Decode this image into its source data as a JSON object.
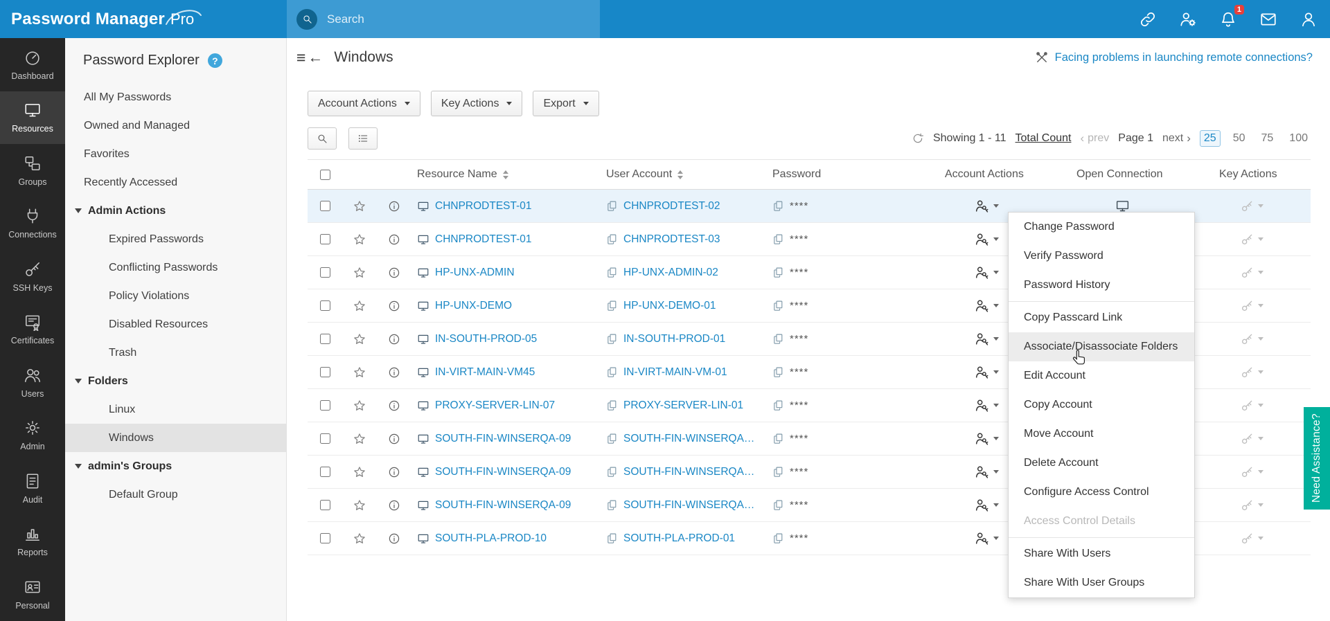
{
  "topbar": {
    "brand": {
      "name": "Password Manager",
      "suffix": "Pro"
    },
    "search": {
      "placeholder": "Search"
    },
    "notification_badge": "1",
    "icons": [
      "remote-connection",
      "user-settings",
      "notifications",
      "mail",
      "profile"
    ]
  },
  "nav": {
    "items": [
      {
        "id": "dashboard",
        "label": "Dashboard",
        "active": false
      },
      {
        "id": "resources",
        "label": "Resources",
        "active": true
      },
      {
        "id": "groups",
        "label": "Groups",
        "active": false
      },
      {
        "id": "connections",
        "label": "Connections",
        "active": false
      },
      {
        "id": "ssh-keys",
        "label": "SSH Keys",
        "active": false
      },
      {
        "id": "certificates",
        "label": "Certificates",
        "active": false
      },
      {
        "id": "users",
        "label": "Users",
        "active": false
      },
      {
        "id": "admin",
        "label": "Admin",
        "active": false
      },
      {
        "id": "audit",
        "label": "Audit",
        "active": false
      },
      {
        "id": "reports",
        "label": "Reports",
        "active": false
      },
      {
        "id": "personal",
        "label": "Personal",
        "active": false
      }
    ]
  },
  "explorer": {
    "title": "Password Explorer",
    "items": [
      {
        "label": "All My Passwords",
        "type": "item"
      },
      {
        "label": "Owned and Managed",
        "type": "item"
      },
      {
        "label": "Favorites",
        "type": "item"
      },
      {
        "label": "Recently Accessed",
        "type": "item"
      },
      {
        "label": "Admin Actions",
        "type": "section"
      },
      {
        "label": "Expired Passwords",
        "type": "child"
      },
      {
        "label": "Conflicting Passwords",
        "type": "child"
      },
      {
        "label": "Policy Violations",
        "type": "child"
      },
      {
        "label": "Disabled Resources",
        "type": "child"
      },
      {
        "label": "Trash",
        "type": "child"
      },
      {
        "label": "Folders",
        "type": "section"
      },
      {
        "label": "Linux",
        "type": "child"
      },
      {
        "label": "Windows",
        "type": "child",
        "selected": true
      },
      {
        "label": "admin's Groups",
        "type": "section"
      },
      {
        "label": "Default Group",
        "type": "child"
      }
    ]
  },
  "main": {
    "title": "Windows",
    "help_link": "Facing problems in launching remote connections?",
    "toolbar": [
      {
        "label": "Account Actions"
      },
      {
        "label": "Key Actions"
      },
      {
        "label": "Export"
      }
    ],
    "pagination": {
      "showing": "Showing 1 - 11",
      "total_count_link": "Total Count",
      "prev": "prev",
      "page": "Page 1",
      "next": "next",
      "page_sizes": [
        "25",
        "50",
        "75",
        "100"
      ],
      "selected_size": "25"
    },
    "table": {
      "columns": [
        {
          "label": "Resource Name",
          "sortable": true
        },
        {
          "label": "User Account",
          "sortable": true
        },
        {
          "label": "Password",
          "sortable": false
        },
        {
          "label": "Account Actions",
          "sortable": false
        },
        {
          "label": "Open Connection",
          "sortable": false
        },
        {
          "label": "Key Actions",
          "sortable": false
        }
      ],
      "password_mask": "****",
      "rows": [
        {
          "resource": "CHNPRODTEST-01",
          "account": "CHNPRODTEST-02",
          "selected": true
        },
        {
          "resource": "CHNPRODTEST-01",
          "account": "CHNPRODTEST-03"
        },
        {
          "resource": "HP-UNX-ADMIN",
          "account": "HP-UNX-ADMIN-02"
        },
        {
          "resource": "HP-UNX-DEMO",
          "account": "HP-UNX-DEMO-01"
        },
        {
          "resource": "IN-SOUTH-PROD-05",
          "account": "IN-SOUTH-PROD-01"
        },
        {
          "resource": "IN-VIRT-MAIN-VM45",
          "account": "IN-VIRT-MAIN-VM-01"
        },
        {
          "resource": "PROXY-SERVER-LIN-07",
          "account": "PROXY-SERVER-LIN-01"
        },
        {
          "resource": "SOUTH-FIN-WINSERQA-09",
          "account": "SOUTH-FIN-WINSERQA…"
        },
        {
          "resource": "SOUTH-FIN-WINSERQA-09",
          "account": "SOUTH-FIN-WINSERQA…"
        },
        {
          "resource": "SOUTH-FIN-WINSERQA-09",
          "account": "SOUTH-FIN-WINSERQA…"
        },
        {
          "resource": "SOUTH-PLA-PROD-10",
          "account": "SOUTH-PLA-PROD-01"
        }
      ]
    }
  },
  "context_menu": {
    "items": [
      {
        "label": "Change Password"
      },
      {
        "label": "Verify Password"
      },
      {
        "label": "Password History",
        "divider_after": true
      },
      {
        "label": "Copy Passcard Link"
      },
      {
        "label": "Associate/Disassociate Folders",
        "highlighted": true
      },
      {
        "label": "Edit Account"
      },
      {
        "label": "Copy Account"
      },
      {
        "label": "Move Account"
      },
      {
        "label": "Delete Account"
      },
      {
        "label": "Configure Access Control"
      },
      {
        "label": "Access Control Details",
        "disabled": true,
        "divider_after": true
      },
      {
        "label": "Share With Users"
      },
      {
        "label": "Share With User Groups"
      }
    ]
  },
  "assistance": {
    "label": "Need Assistance?"
  },
  "colors": {
    "topbar": "#1787c8",
    "search-bg": "#3d9bd3",
    "accent": "#1a87c5",
    "sidebar": "#262626",
    "assist": "#00b09c",
    "badge": "#e8403a",
    "row-selected": "#e9f3fb"
  }
}
